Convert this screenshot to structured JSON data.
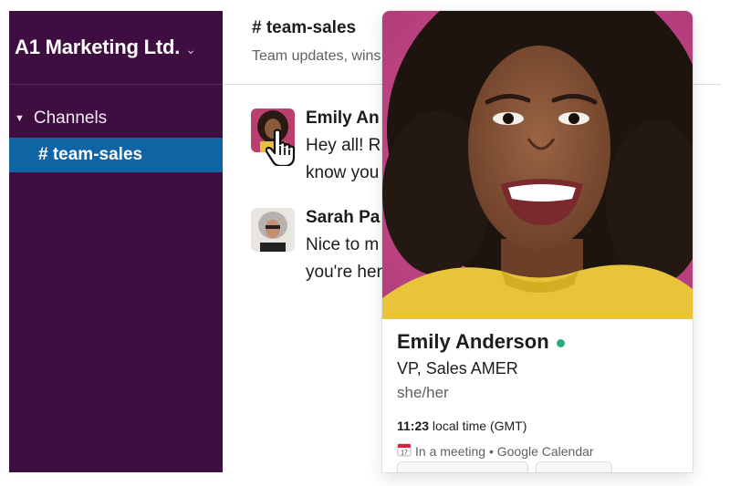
{
  "workspace": {
    "name": "A1 Marketing Ltd.",
    "chevron_icon": "chevron-down-icon"
  },
  "sidebar": {
    "section_label": "Channels",
    "active_channel": "# team-sales"
  },
  "channel": {
    "title": "# team-sales",
    "description": "Team updates, wins"
  },
  "messages": [
    {
      "author": "Emily An",
      "lines": [
        "Hey all! R",
        "know you"
      ]
    },
    {
      "author": "Sarah Pa",
      "lines": [
        "Nice to m",
        "you're her"
      ]
    }
  ],
  "profile": {
    "name": "Emily Anderson",
    "title": "VP, Sales AMER",
    "pronouns": "she/her",
    "time": "11:23",
    "time_suffix": " local time (GMT)",
    "status": "In a meeting • Google Calendar",
    "presence_color": "#2bac76"
  },
  "colors": {
    "sidebar_bg": "#3f0e40",
    "active_channel_bg": "#1164a3"
  }
}
